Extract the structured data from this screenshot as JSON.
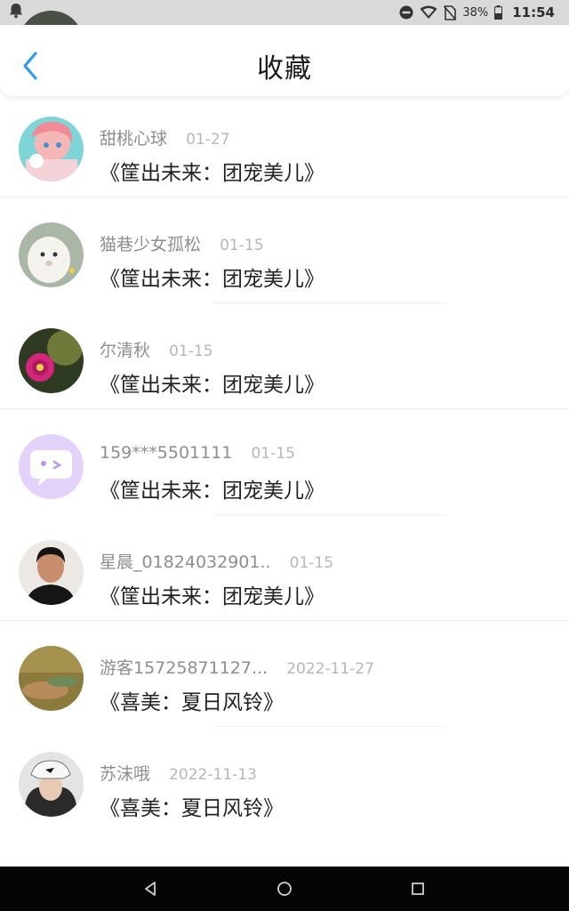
{
  "status_bar": {
    "icons": [
      "notification-icon",
      "do-not-disturb-icon",
      "wifi-icon",
      "no-sim-icon",
      "battery-icon"
    ],
    "battery": "38%",
    "time": "11:54"
  },
  "header": {
    "title": "收藏",
    "back_icon": "chevron-left-icon",
    "accent_color": "#2d9bf0"
  },
  "favorites": [
    {
      "name": "",
      "date": "",
      "title": "",
      "avatar": "dark-photo"
    },
    {
      "name": "甜桃心球",
      "date": "01-27",
      "title": "《筐出未来：团宠美儿》",
      "avatar": "anime-girl"
    },
    {
      "name": "猫巷少女孤松",
      "date": "01-15",
      "title": "《筐出未来：团宠美儿》",
      "avatar": "white-alpaca"
    },
    {
      "name": "尔清秋",
      "date": "01-15",
      "title": "《筐出未来：团宠美儿》",
      "avatar": "cactus-flower"
    },
    {
      "name": "159***5501111",
      "date": "01-15",
      "title": "《筐出未来：团宠美儿》",
      "avatar": "purple-chat-bubble"
    },
    {
      "name": "星晨_01824032901..",
      "date": "01-15",
      "title": "《筐出未来：团宠美儿》",
      "avatar": "person-photo"
    },
    {
      "name": "游客15725871127...",
      "date": "2022-11-27",
      "title": "《喜美：夏日风铃》",
      "avatar": "golden-field"
    },
    {
      "name": "苏沫哦",
      "date": "2022-11-13",
      "title": "《喜美：夏日风铃》",
      "avatar": "girl-white-cap"
    }
  ],
  "nav_bar": {
    "buttons": [
      "back-triangle-icon",
      "home-circle-icon",
      "recents-square-icon"
    ]
  }
}
